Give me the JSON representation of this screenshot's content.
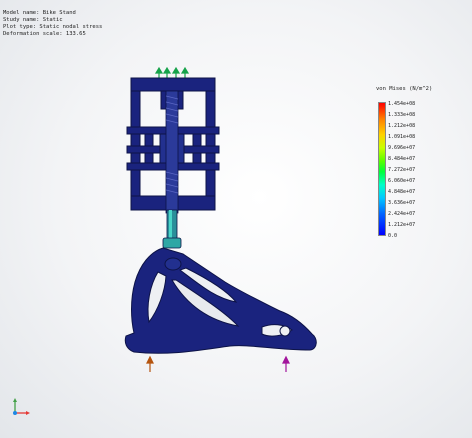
{
  "info": {
    "lines": [
      "Model name: Bike Stand",
      "Study name: Static",
      "Plot type: Static nodal stress",
      "Deformation scale: 133.65"
    ]
  },
  "legend": {
    "title": "von Mises (N/m^2)",
    "ticks": [
      "1.454e+08",
      "1.333e+08",
      "1.212e+08",
      "1.091e+08",
      "9.696e+07",
      "8.484e+07",
      "7.272e+07",
      "6.060e+07",
      "4.848e+07",
      "3.636e+07",
      "2.424e+07",
      "1.212e+07",
      "0.0"
    ],
    "colors": {
      "max": "#ff0000",
      "min": "#0000ff"
    }
  },
  "model": {
    "body_color": "#1a237e",
    "stress_color": "#2ec4b6",
    "load_arrow_color": "#17a34a",
    "fixture_left_color": "#b5540f",
    "fixture_right_color": "#a2159c"
  },
  "triad": {
    "x_color": "#e53935",
    "y_color": "#43a047",
    "z_color": "#1e88e5"
  }
}
